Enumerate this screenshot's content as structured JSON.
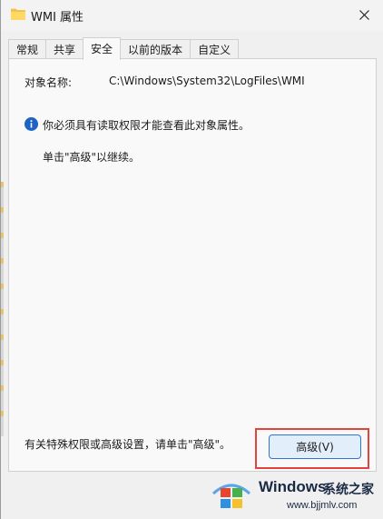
{
  "window": {
    "title": "WMI 属性",
    "close_icon": "close-icon",
    "folder_icon": "folder-icon"
  },
  "tabs": [
    {
      "label": "常规",
      "active": false
    },
    {
      "label": "共享",
      "active": false
    },
    {
      "label": "安全",
      "active": true
    },
    {
      "label": "以前的版本",
      "active": false
    },
    {
      "label": "自定义",
      "active": false
    }
  ],
  "security": {
    "object_name_label": "对象名称:",
    "object_name_value": "C:\\Windows\\System32\\LogFiles\\WMI",
    "info_icon": "info-icon",
    "permission_message": "你必须具有读取权限才能查看此对象属性。",
    "continue_message": "单击\"高级\"以继续。",
    "advanced_hint": "有关特殊权限或高级设置，请单击\"高级\"。",
    "advanced_button": "高级(V)"
  },
  "watermark": {
    "brand": "Windows",
    "brand_cn": "系统之家",
    "url": "www.bjjmlv.com"
  },
  "colors": {
    "accent": "#2f74d0",
    "highlight": "#e0453c",
    "info": "#1e63c4"
  }
}
